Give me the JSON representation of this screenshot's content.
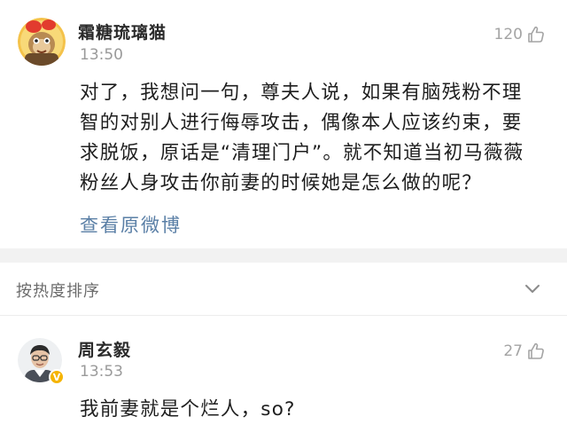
{
  "post": {
    "username": "霜糖琉璃猫",
    "time": "13:50",
    "likes": "120",
    "lines": [
      "对了，我想问一句，尊夫人说，如果有脑残粉不理",
      "智的对别人进行侮辱攻击，偶像本人应该约束，要",
      "求脱饭，原话是“清理门户”。就不知道当初马薇薇",
      "粉丝人身攻击你前妻的时候她是怎么做的呢？"
    ],
    "view_original": "查看原微博"
  },
  "sort": {
    "label": "按热度排序",
    "chevron_icon": "chevron-down-icon"
  },
  "reply": {
    "username": "周玄毅",
    "time": "13:53",
    "likes": "27",
    "text": "我前妻就是个烂人，so?",
    "verified_badge": "V",
    "badge_color": "#f5b400"
  },
  "colors": {
    "link": "#5a7fa6",
    "divider": "#f2f2f2"
  }
}
